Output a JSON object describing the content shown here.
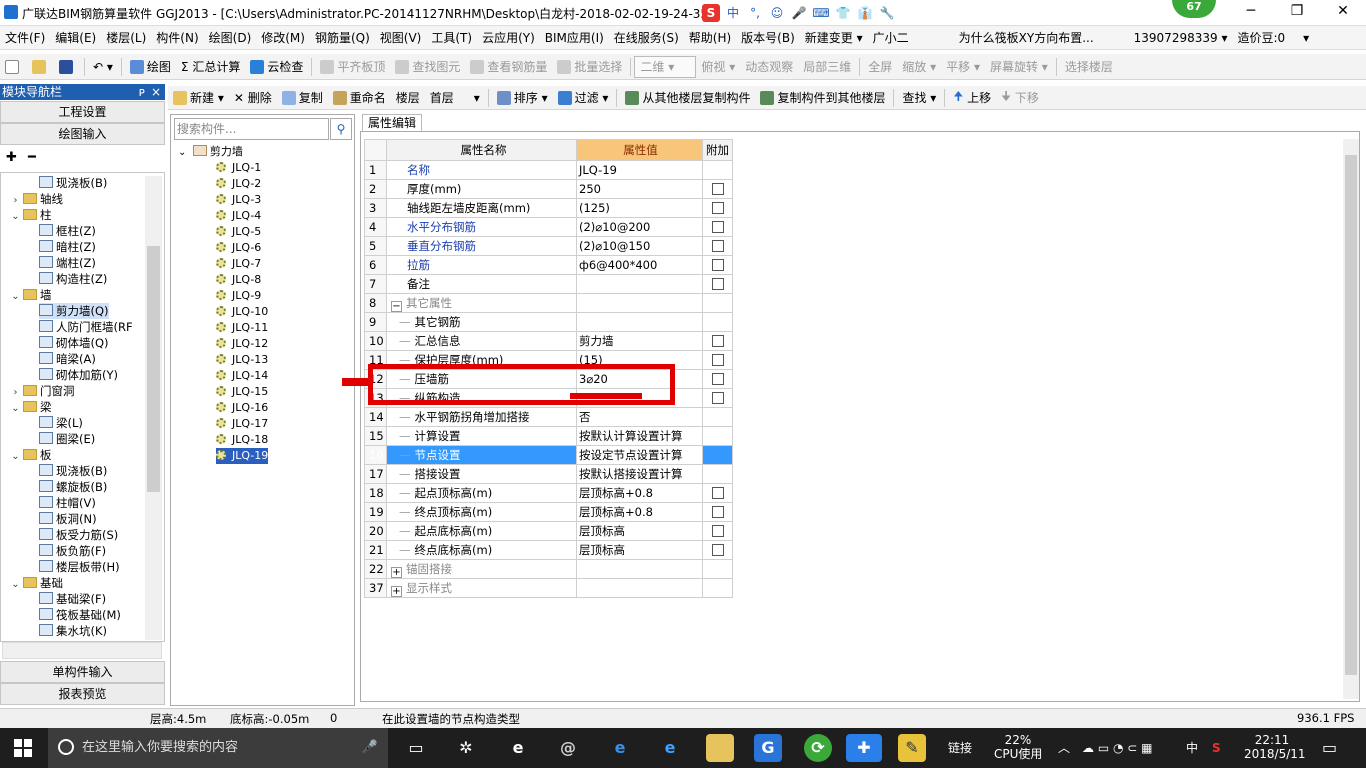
{
  "window": {
    "title": "广联达BIM钢筋算量软件 GGJ2013 - [C:\\Users\\Administrator.PC-20141127NRHM\\Desktop\\白龙村-2018-02-02-19-24-35",
    "badge": "67",
    "min": "─",
    "max": "❐",
    "close": "✕"
  },
  "ime": [
    "S",
    "中",
    "°,",
    "☺",
    "🎤",
    "⌨",
    "👕",
    "👔",
    "🔧"
  ],
  "menu": [
    "文件(F)",
    "编辑(E)",
    "楼层(L)",
    "构件(N)",
    "绘图(D)",
    "修改(M)",
    "钢筋量(Q)",
    "视图(V)",
    "工具(T)",
    "云应用(Y)",
    "BIM应用(I)",
    "在线服务(S)",
    "帮助(H)",
    "版本号(B)",
    "新建变更 ▾",
    "广小二",
    "为什么筏板XY方向布置...",
    "13907298339 ▾",
    "造价豆:0",
    "▾"
  ],
  "toolbar1": [
    "绘图",
    "Σ 汇总计算",
    "云检查",
    "平齐板顶",
    "查找图元",
    "查看钢筋量",
    "批量选择",
    "二维",
    "俯视 ▾",
    "动态观察",
    "局部三维",
    "全屏",
    "缩放 ▾",
    "平移 ▾",
    "屏幕旋转 ▾",
    "选择楼层"
  ],
  "nav": {
    "header": "模块导航栏",
    "pin": "ᴘ",
    "close": "×",
    "btn_project": "工程设置",
    "btn_draw": "绘图输入",
    "btn_single": "单构件输入",
    "btn_report": "报表预览",
    "expand": "✚",
    "collapse": "━"
  },
  "tree": [
    {
      "t": "现浇板(B)",
      "lvl": 2
    },
    {
      "t": "轴线",
      "lvl": 1,
      "tog": "›"
    },
    {
      "t": "柱",
      "lvl": 1,
      "tog": "⌄"
    },
    {
      "t": "框柱(Z)",
      "lvl": 2
    },
    {
      "t": "暗柱(Z)",
      "lvl": 2
    },
    {
      "t": "端柱(Z)",
      "lvl": 2
    },
    {
      "t": "构造柱(Z)",
      "lvl": 2
    },
    {
      "t": "墙",
      "lvl": 1,
      "tog": "⌄"
    },
    {
      "t": "剪力墙(Q)",
      "lvl": 2,
      "sel": true
    },
    {
      "t": "人防门框墙(RF",
      "lvl": 2
    },
    {
      "t": "砌体墙(Q)",
      "lvl": 2
    },
    {
      "t": "暗梁(A)",
      "lvl": 2
    },
    {
      "t": "砌体加筋(Y)",
      "lvl": 2
    },
    {
      "t": "门窗洞",
      "lvl": 1,
      "tog": "›"
    },
    {
      "t": "梁",
      "lvl": 1,
      "tog": "⌄"
    },
    {
      "t": "梁(L)",
      "lvl": 2
    },
    {
      "t": "圈梁(E)",
      "lvl": 2
    },
    {
      "t": "板",
      "lvl": 1,
      "tog": "⌄"
    },
    {
      "t": "现浇板(B)",
      "lvl": 2
    },
    {
      "t": "螺旋板(B)",
      "lvl": 2
    },
    {
      "t": "柱帽(V)",
      "lvl": 2
    },
    {
      "t": "板洞(N)",
      "lvl": 2
    },
    {
      "t": "板受力筋(S)",
      "lvl": 2
    },
    {
      "t": "板负筋(F)",
      "lvl": 2
    },
    {
      "t": "楼层板带(H)",
      "lvl": 2
    },
    {
      "t": "基础",
      "lvl": 1,
      "tog": "⌄"
    },
    {
      "t": "基础梁(F)",
      "lvl": 2
    },
    {
      "t": "筏板基础(M)",
      "lvl": 2
    },
    {
      "t": "集水坑(K)",
      "lvl": 2
    }
  ],
  "toolbar2": [
    "新建 ▾",
    "✕ 删除",
    "复制",
    "重命名",
    "楼层",
    "首层",
    "▾",
    "排序 ▾",
    "过滤 ▾",
    "从其他楼层复制构件",
    "复制构件到其他楼层",
    "查找 ▾",
    "上移",
    "下移"
  ],
  "list": {
    "search_placeholder": "搜索构件...",
    "root": "剪力墙",
    "items": [
      "JLQ-1",
      "JLQ-2",
      "JLQ-3",
      "JLQ-4",
      "JLQ-5",
      "JLQ-6",
      "JLQ-7",
      "JLQ-8",
      "JLQ-9",
      "JLQ-10",
      "JLQ-11",
      "JLQ-12",
      "JLQ-13",
      "JLQ-14",
      "JLQ-15",
      "JLQ-16",
      "JLQ-17",
      "JLQ-18",
      "JLQ-19"
    ],
    "selected": "JLQ-19"
  },
  "props": {
    "tab": "属性编辑",
    "headers": [
      "属性名称",
      "属性值",
      "附加"
    ],
    "rows": [
      {
        "n": "1",
        "name": "名称",
        "val": "JLQ-19",
        "cb": false,
        "blue": true
      },
      {
        "n": "2",
        "name": "厚度(mm)",
        "val": "250",
        "cb": true
      },
      {
        "n": "3",
        "name": "轴线距左墙皮距离(mm)",
        "val": "(125)",
        "cb": true
      },
      {
        "n": "4",
        "name": "水平分布钢筋",
        "val": "(2)⌀10@200",
        "cb": true,
        "blue": true
      },
      {
        "n": "5",
        "name": "垂直分布钢筋",
        "val": "(2)⌀10@150",
        "cb": true,
        "blue": true
      },
      {
        "n": "6",
        "name": "拉筋",
        "val": "ф6@400*400",
        "cb": true,
        "blue": true
      },
      {
        "n": "7",
        "name": "备注",
        "val": "",
        "cb": true
      },
      {
        "n": "8",
        "name": "其它属性",
        "val": "",
        "group": "−",
        "grey": true
      },
      {
        "n": "9",
        "name": "其它钢筋",
        "val": "",
        "sub": true
      },
      {
        "n": "10",
        "name": "汇总信息",
        "val": "剪力墙",
        "cb": true,
        "sub": true
      },
      {
        "n": "11",
        "name": "保护层厚度(mm)",
        "val": "(15)",
        "cb": true,
        "sub": true
      },
      {
        "n": "12",
        "name": "压墙筋",
        "val": "3⌀20",
        "cb": true,
        "sub": true
      },
      {
        "n": "13",
        "name": "纵筋构造",
        "val": "",
        "cb": true,
        "sub": true
      },
      {
        "n": "14",
        "name": "水平钢筋拐角增加搭接",
        "val": "否",
        "sub": true
      },
      {
        "n": "15",
        "name": "计算设置",
        "val": "按默认计算设置计算",
        "sub": true
      },
      {
        "n": "16",
        "name": "节点设置",
        "val": "按设定节点设置计算",
        "sub": true,
        "hl": true
      },
      {
        "n": "17",
        "name": "搭接设置",
        "val": "按默认搭接设置计算",
        "sub": true
      },
      {
        "n": "18",
        "name": "起点顶标高(m)",
        "val": "层顶标高+0.8",
        "cb": true,
        "sub": true
      },
      {
        "n": "19",
        "name": "终点顶标高(m)",
        "val": "层顶标高+0.8",
        "cb": true,
        "sub": true
      },
      {
        "n": "20",
        "name": "起点底标高(m)",
        "val": "层顶标高",
        "cb": true,
        "sub": true
      },
      {
        "n": "21",
        "name": "终点底标高(m)",
        "val": "层顶标高",
        "cb": true,
        "sub": true
      },
      {
        "n": "22",
        "name": "锚固搭接",
        "val": "",
        "group": "+",
        "grey": true
      },
      {
        "n": "37",
        "name": "显示样式",
        "val": "",
        "group": "+",
        "grey": true
      }
    ]
  },
  "status": {
    "floor_height": "层高:4.5m",
    "bottom_elev": "底标高:-0.05m",
    "zero": "0",
    "hint": "在此设置墙的节点构造类型",
    "fps": "936.1 FPS"
  },
  "taskbar": {
    "search": "在这里输入你要搜索的内容",
    "link": "链接",
    "cpu": "22%",
    "cpu_label": "CPU使用",
    "time": "22:11",
    "date": "2018/5/11",
    "ime": "中",
    "up": "︿"
  },
  "colors": {
    "accent": "#3399ff",
    "highlight_box": "#e00000",
    "nav_header": "#1f5fb0"
  }
}
